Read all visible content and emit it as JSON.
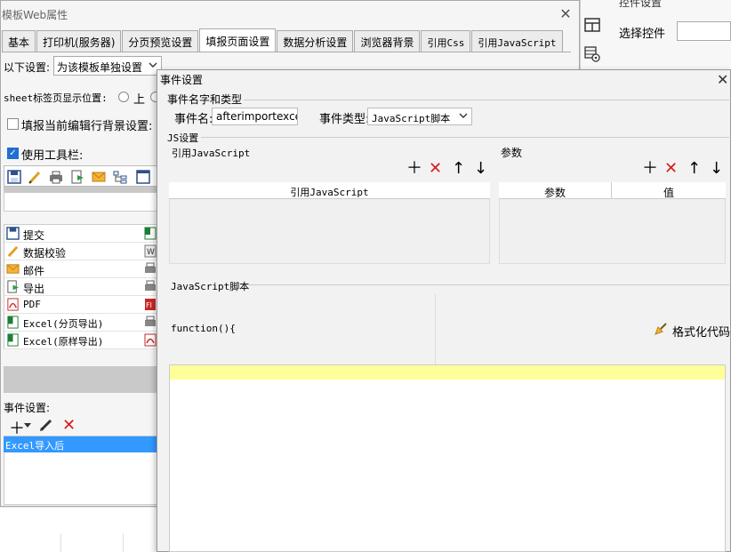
{
  "right_panel": {
    "title": "控件设置",
    "select_control_label": "选择控件",
    "icons": [
      "layout-icon",
      "settings-grid-icon"
    ]
  },
  "props_window": {
    "title": "模板Web属性",
    "tabs": [
      {
        "label": "基本",
        "active": false
      },
      {
        "label": "打印机(服务器)",
        "active": false
      },
      {
        "label": "分页预览设置",
        "active": false
      },
      {
        "label": "填报页面设置",
        "active": true
      },
      {
        "label": "数据分析设置",
        "active": false
      },
      {
        "label": "浏览器背景",
        "active": false
      },
      {
        "label": "引用Css",
        "active": false
      },
      {
        "label": "引用JavaScript",
        "active": false
      }
    ],
    "settings_label": "以下设置:",
    "settings_value": "为该模板单独设置",
    "sheet_position_label": "sheet标签页显示位置:",
    "sheet_position_option_top": "上",
    "highlight_row_label": "填报当前编辑行背景设置:",
    "highlight_row_checked": false,
    "use_toolbar_label": "使用工具栏:",
    "use_toolbar_checked": true,
    "toolbar_icons": [
      "save-icon",
      "edit-check-icon",
      "print-icon",
      "export-icon",
      "mail-icon",
      "tree-icon",
      "window-icon"
    ],
    "buttons": [
      {
        "label": "提交",
        "icon": "save-icon"
      },
      {
        "label": "数据校验",
        "icon": "edit-check-icon"
      },
      {
        "label": "邮件",
        "icon": "mail-icon"
      },
      {
        "label": "导出",
        "icon": "export-icon"
      },
      {
        "label": "PDF",
        "icon": "pdf-icon"
      },
      {
        "label": "Excel(分页导出)",
        "icon": "excel-icon"
      },
      {
        "label": "Excel(原样导出)",
        "icon": "excel-icon"
      }
    ],
    "event_settings_label": "事件设置:",
    "events": [
      {
        "label": "Excel导入后",
        "selected": true
      }
    ]
  },
  "event_dialog": {
    "title": "事件设置",
    "name_and_type_group": "事件名字和类型",
    "event_name_label": "事件名:",
    "event_name_value": "afterimportexcel",
    "event_type_label": "事件类型:",
    "event_type_value": "JavaScript脚本",
    "js_settings_group": "JS设置",
    "ref_js_label": "引用JavaScript",
    "params_label": "参数",
    "ref_js_column": "引用JavaScript",
    "params_columns": [
      "参数",
      "值"
    ],
    "script_group": "JavaScript脚本",
    "function_header": "function(){",
    "format_code_label": "格式化代码",
    "accent_colors": {
      "delete": "#d81b1b",
      "selection": "#3399ff",
      "editor_highlight": "#ffff99"
    }
  }
}
